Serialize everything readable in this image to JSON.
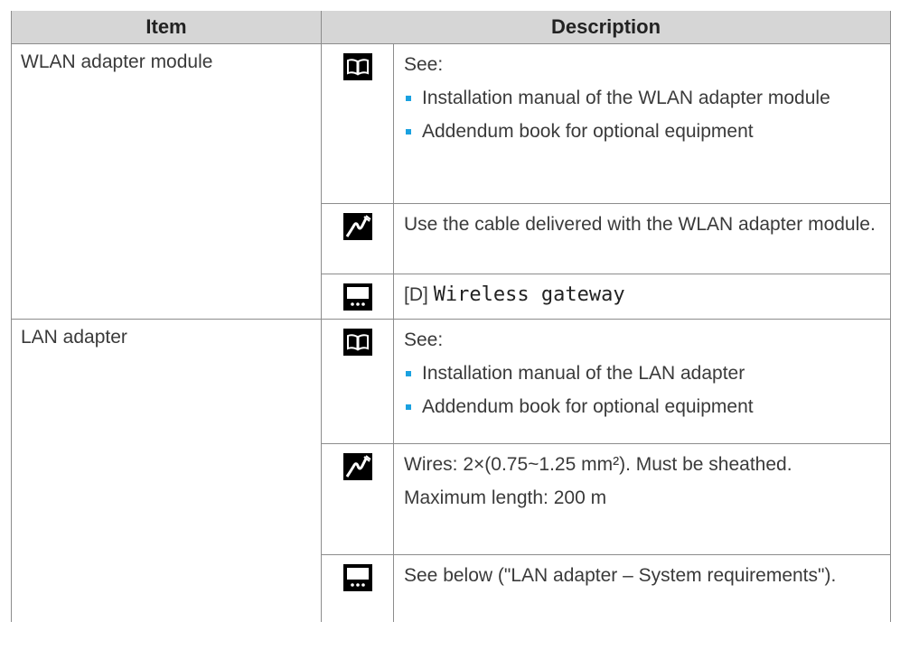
{
  "table": {
    "headers": {
      "item": "Item",
      "description": "Description"
    },
    "rows": [
      {
        "item": "WLAN adapter module",
        "sections": [
          {
            "icon": "book-icon",
            "intro": "See:",
            "bullets": [
              "Installation manual of the WLAN adapter module",
              "Addendum book for optional equipment"
            ]
          },
          {
            "icon": "cable-icon",
            "text": "Use the cable delivered with the WLAN adapter module."
          },
          {
            "icon": "controller-icon",
            "prefix": "[D]",
            "code": "Wireless gateway"
          }
        ]
      },
      {
        "item": "LAN adapter",
        "sections": [
          {
            "icon": "book-icon",
            "intro": "See:",
            "bullets": [
              "Installation manual of the LAN adapter",
              "Addendum book for optional equipment"
            ]
          },
          {
            "icon": "cable-icon",
            "text": "Wires: 2×(0.75~1.25 mm²). Must be sheathed.",
            "text2": "Maximum length: 200 m"
          },
          {
            "icon": "controller-icon",
            "text": "See below (\"LAN adapter – System requirements\")."
          }
        ]
      }
    ]
  },
  "colors": {
    "header_bg": "#d6d6d6",
    "bullet": "#1aa1e0",
    "border": "#8c8c8c"
  }
}
